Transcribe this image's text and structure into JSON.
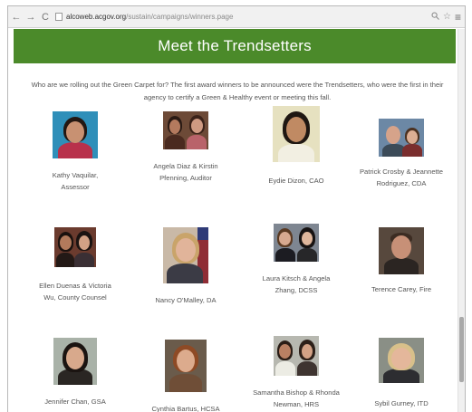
{
  "browser": {
    "back": "←",
    "forward": "→",
    "reload": "C",
    "url_host": "alcoweb.acgov.org",
    "url_path": "/sustain/campaigns/winners.page",
    "zoom_icon": "search-icon",
    "star_icon": "star-icon",
    "menu_icon": "menu-icon"
  },
  "banner": {
    "title": "Meet the Trendsetters",
    "color": "#4b8a2a"
  },
  "intro": "Who are we rolling out the Green Carpet for? The first award winners to be announced were the Trendsetters, who were the first in their agency to certify a Green & Healthy event or meeting this fall.",
  "winners": [
    {
      "caption": "Kathy Vaquilar, Assessor"
    },
    {
      "caption": "Angela Diaz & Kirstin Pfenning, Auditor"
    },
    {
      "caption": "Eydie Dizon, CAO"
    },
    {
      "caption": "Patrick Crosby & Jeannette Rodriguez, CDA"
    },
    {
      "caption": "Ellen Duenas & Victoria Wu, County Counsel"
    },
    {
      "caption": "Nancy O'Malley, DA"
    },
    {
      "caption": "Laura Kitsch & Angela Zhang, DCSS"
    },
    {
      "caption": "Terence Carey, Fire"
    },
    {
      "caption": "Jennifer Chan, GSA"
    },
    {
      "caption": "Cynthia Bartus, HCSA"
    },
    {
      "caption": "Samantha Bishop & Rhonda Newman, HRS"
    },
    {
      "caption": "Sybil Gurney, ITD"
    }
  ]
}
